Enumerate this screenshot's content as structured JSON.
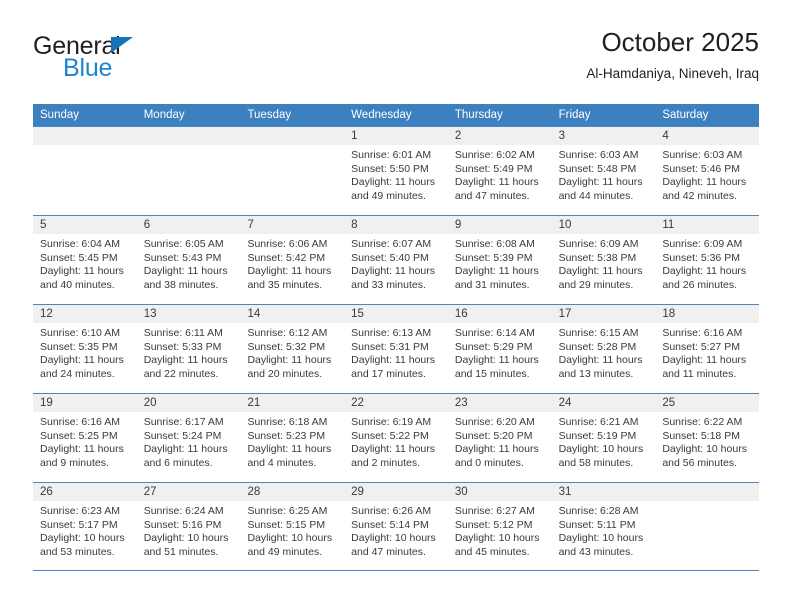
{
  "brand": {
    "name_top": "General",
    "name_bottom": "Blue",
    "accent_dark": "#231f20",
    "accent_blue": "#1c84d0",
    "triangle_color": "#1573ba"
  },
  "header": {
    "title": "October 2025",
    "subtitle": "Al-Hamdaniya, Nineveh, Iraq"
  },
  "theme": {
    "header_bar": "#3c80c0",
    "day_band": "#f0f0f0",
    "row_rule": "#4a86c4",
    "text": "#3a3a3a"
  },
  "calendar": {
    "weekdays": [
      "Sunday",
      "Monday",
      "Tuesday",
      "Wednesday",
      "Thursday",
      "Friday",
      "Saturday"
    ],
    "weeks": [
      [
        {
          "day": "",
          "sunrise": "",
          "sunset": "",
          "daylight_1": "",
          "daylight_2": ""
        },
        {
          "day": "",
          "sunrise": "",
          "sunset": "",
          "daylight_1": "",
          "daylight_2": ""
        },
        {
          "day": "",
          "sunrise": "",
          "sunset": "",
          "daylight_1": "",
          "daylight_2": ""
        },
        {
          "day": "1",
          "sunrise": "Sunrise: 6:01 AM",
          "sunset": "Sunset: 5:50 PM",
          "daylight_1": "Daylight: 11 hours",
          "daylight_2": "and 49 minutes."
        },
        {
          "day": "2",
          "sunrise": "Sunrise: 6:02 AM",
          "sunset": "Sunset: 5:49 PM",
          "daylight_1": "Daylight: 11 hours",
          "daylight_2": "and 47 minutes."
        },
        {
          "day": "3",
          "sunrise": "Sunrise: 6:03 AM",
          "sunset": "Sunset: 5:48 PM",
          "daylight_1": "Daylight: 11 hours",
          "daylight_2": "and 44 minutes."
        },
        {
          "day": "4",
          "sunrise": "Sunrise: 6:03 AM",
          "sunset": "Sunset: 5:46 PM",
          "daylight_1": "Daylight: 11 hours",
          "daylight_2": "and 42 minutes."
        }
      ],
      [
        {
          "day": "5",
          "sunrise": "Sunrise: 6:04 AM",
          "sunset": "Sunset: 5:45 PM",
          "daylight_1": "Daylight: 11 hours",
          "daylight_2": "and 40 minutes."
        },
        {
          "day": "6",
          "sunrise": "Sunrise: 6:05 AM",
          "sunset": "Sunset: 5:43 PM",
          "daylight_1": "Daylight: 11 hours",
          "daylight_2": "and 38 minutes."
        },
        {
          "day": "7",
          "sunrise": "Sunrise: 6:06 AM",
          "sunset": "Sunset: 5:42 PM",
          "daylight_1": "Daylight: 11 hours",
          "daylight_2": "and 35 minutes."
        },
        {
          "day": "8",
          "sunrise": "Sunrise: 6:07 AM",
          "sunset": "Sunset: 5:40 PM",
          "daylight_1": "Daylight: 11 hours",
          "daylight_2": "and 33 minutes."
        },
        {
          "day": "9",
          "sunrise": "Sunrise: 6:08 AM",
          "sunset": "Sunset: 5:39 PM",
          "daylight_1": "Daylight: 11 hours",
          "daylight_2": "and 31 minutes."
        },
        {
          "day": "10",
          "sunrise": "Sunrise: 6:09 AM",
          "sunset": "Sunset: 5:38 PM",
          "daylight_1": "Daylight: 11 hours",
          "daylight_2": "and 29 minutes."
        },
        {
          "day": "11",
          "sunrise": "Sunrise: 6:09 AM",
          "sunset": "Sunset: 5:36 PM",
          "daylight_1": "Daylight: 11 hours",
          "daylight_2": "and 26 minutes."
        }
      ],
      [
        {
          "day": "12",
          "sunrise": "Sunrise: 6:10 AM",
          "sunset": "Sunset: 5:35 PM",
          "daylight_1": "Daylight: 11 hours",
          "daylight_2": "and 24 minutes."
        },
        {
          "day": "13",
          "sunrise": "Sunrise: 6:11 AM",
          "sunset": "Sunset: 5:33 PM",
          "daylight_1": "Daylight: 11 hours",
          "daylight_2": "and 22 minutes."
        },
        {
          "day": "14",
          "sunrise": "Sunrise: 6:12 AM",
          "sunset": "Sunset: 5:32 PM",
          "daylight_1": "Daylight: 11 hours",
          "daylight_2": "and 20 minutes."
        },
        {
          "day": "15",
          "sunrise": "Sunrise: 6:13 AM",
          "sunset": "Sunset: 5:31 PM",
          "daylight_1": "Daylight: 11 hours",
          "daylight_2": "and 17 minutes."
        },
        {
          "day": "16",
          "sunrise": "Sunrise: 6:14 AM",
          "sunset": "Sunset: 5:29 PM",
          "daylight_1": "Daylight: 11 hours",
          "daylight_2": "and 15 minutes."
        },
        {
          "day": "17",
          "sunrise": "Sunrise: 6:15 AM",
          "sunset": "Sunset: 5:28 PM",
          "daylight_1": "Daylight: 11 hours",
          "daylight_2": "and 13 minutes."
        },
        {
          "day": "18",
          "sunrise": "Sunrise: 6:16 AM",
          "sunset": "Sunset: 5:27 PM",
          "daylight_1": "Daylight: 11 hours",
          "daylight_2": "and 11 minutes."
        }
      ],
      [
        {
          "day": "19",
          "sunrise": "Sunrise: 6:16 AM",
          "sunset": "Sunset: 5:25 PM",
          "daylight_1": "Daylight: 11 hours",
          "daylight_2": "and 9 minutes."
        },
        {
          "day": "20",
          "sunrise": "Sunrise: 6:17 AM",
          "sunset": "Sunset: 5:24 PM",
          "daylight_1": "Daylight: 11 hours",
          "daylight_2": "and 6 minutes."
        },
        {
          "day": "21",
          "sunrise": "Sunrise: 6:18 AM",
          "sunset": "Sunset: 5:23 PM",
          "daylight_1": "Daylight: 11 hours",
          "daylight_2": "and 4 minutes."
        },
        {
          "day": "22",
          "sunrise": "Sunrise: 6:19 AM",
          "sunset": "Sunset: 5:22 PM",
          "daylight_1": "Daylight: 11 hours",
          "daylight_2": "and 2 minutes."
        },
        {
          "day": "23",
          "sunrise": "Sunrise: 6:20 AM",
          "sunset": "Sunset: 5:20 PM",
          "daylight_1": "Daylight: 11 hours",
          "daylight_2": "and 0 minutes."
        },
        {
          "day": "24",
          "sunrise": "Sunrise: 6:21 AM",
          "sunset": "Sunset: 5:19 PM",
          "daylight_1": "Daylight: 10 hours",
          "daylight_2": "and 58 minutes."
        },
        {
          "day": "25",
          "sunrise": "Sunrise: 6:22 AM",
          "sunset": "Sunset: 5:18 PM",
          "daylight_1": "Daylight: 10 hours",
          "daylight_2": "and 56 minutes."
        }
      ],
      [
        {
          "day": "26",
          "sunrise": "Sunrise: 6:23 AM",
          "sunset": "Sunset: 5:17 PM",
          "daylight_1": "Daylight: 10 hours",
          "daylight_2": "and 53 minutes."
        },
        {
          "day": "27",
          "sunrise": "Sunrise: 6:24 AM",
          "sunset": "Sunset: 5:16 PM",
          "daylight_1": "Daylight: 10 hours",
          "daylight_2": "and 51 minutes."
        },
        {
          "day": "28",
          "sunrise": "Sunrise: 6:25 AM",
          "sunset": "Sunset: 5:15 PM",
          "daylight_1": "Daylight: 10 hours",
          "daylight_2": "and 49 minutes."
        },
        {
          "day": "29",
          "sunrise": "Sunrise: 6:26 AM",
          "sunset": "Sunset: 5:14 PM",
          "daylight_1": "Daylight: 10 hours",
          "daylight_2": "and 47 minutes."
        },
        {
          "day": "30",
          "sunrise": "Sunrise: 6:27 AM",
          "sunset": "Sunset: 5:12 PM",
          "daylight_1": "Daylight: 10 hours",
          "daylight_2": "and 45 minutes."
        },
        {
          "day": "31",
          "sunrise": "Sunrise: 6:28 AM",
          "sunset": "Sunset: 5:11 PM",
          "daylight_1": "Daylight: 10 hours",
          "daylight_2": "and 43 minutes."
        },
        {
          "day": "",
          "sunrise": "",
          "sunset": "",
          "daylight_1": "",
          "daylight_2": ""
        }
      ]
    ]
  }
}
